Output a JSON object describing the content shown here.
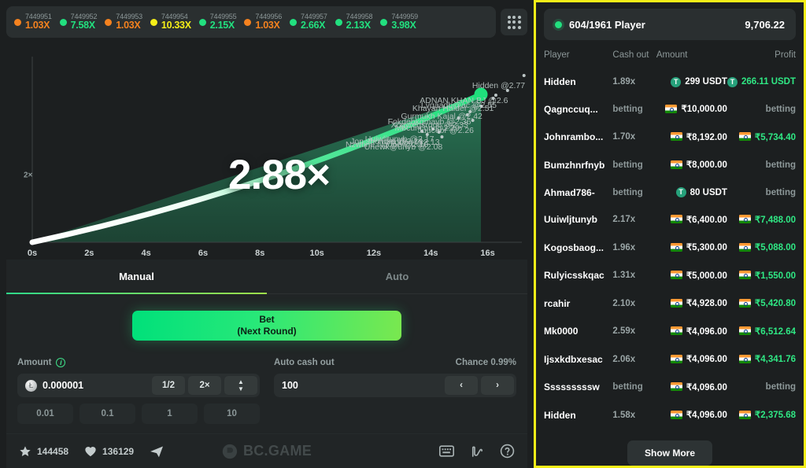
{
  "history": {
    "items": [
      {
        "id": "7449951",
        "mult": "1.03X",
        "color": "#f5821f"
      },
      {
        "id": "7449952",
        "mult": "7.58X",
        "color": "#22e07f"
      },
      {
        "id": "7449953",
        "mult": "1.03X",
        "color": "#f5821f"
      },
      {
        "id": "7449954",
        "mult": "10.33X",
        "color": "#f5ee18"
      },
      {
        "id": "7449955",
        "mult": "2.15X",
        "color": "#22e07f"
      },
      {
        "id": "7449956",
        "mult": "1.03X",
        "color": "#f5821f"
      },
      {
        "id": "7449957",
        "mult": "2.66X",
        "color": "#22e07f"
      },
      {
        "id": "7449958",
        "mult": "2.13X",
        "color": "#22e07f"
      },
      {
        "id": "7449959",
        "mult": "3.98X",
        "color": "#22e07f"
      }
    ],
    "grid_button_icon": "grid-3x3-icon"
  },
  "chart_data": {
    "type": "line",
    "title": "",
    "current_multiplier": "2.88×",
    "xlabel": "",
    "ylabel": "",
    "grid": false,
    "x_ticks": [
      "0s",
      "2s",
      "4s",
      "6s",
      "8s",
      "10s",
      "12s",
      "14s",
      "16s"
    ],
    "y_ticks": [
      "2×"
    ],
    "xlim": [
      0,
      17.2
    ],
    "ylim": [
      1,
      3.1
    ],
    "line_color_start": "#ffffff",
    "line_color_end": "#22e07f",
    "fill_color": "#1d5c42",
    "x": [
      0,
      2,
      4,
      6,
      8,
      10,
      12,
      14,
      16,
      17
    ],
    "y": [
      1.0,
      1.12,
      1.28,
      1.47,
      1.7,
      1.96,
      2.22,
      2.5,
      2.78,
      2.88
    ],
    "annotations": [
      {
        "label": "Hidden @2.77",
        "x": 15.6,
        "y": 2.77
      },
      {
        "label": "ADNAN KHAN BJ @2.6",
        "x": 15.0,
        "y": 2.6
      },
      {
        "label": "Lvqaadb@ac @2.55",
        "x": 14.6,
        "y": 2.55
      },
      {
        "label": "Khayan Haider @2.51",
        "x": 14.5,
        "y": 2.51
      },
      {
        "label": "Gurmukh Kajal @2.42",
        "x": 14.1,
        "y": 2.42
      },
      {
        "label": "Fokdebkqmavb @2.36",
        "x": 13.7,
        "y": 2.36
      },
      {
        "label": "Xcgyregsrqqc @2.33",
        "x": 13.6,
        "y": 2.33
      },
      {
        "label": "Mbcuncon @2.29",
        "x": 13.3,
        "y": 2.29
      },
      {
        "label": "Juuceor @2.26",
        "x": 13.8,
        "y": 2.26
      },
      {
        "label": "Uuiwljtunyb @2.17",
        "x": 12.4,
        "y": 2.17
      },
      {
        "label": "Jon Jhondra @2.14",
        "x": 12.0,
        "y": 2.14
      },
      {
        "label": "Hidden @2.13",
        "x": 12.6,
        "y": 2.13
      },
      {
        "label": "Nzwtine Ngope @2.10",
        "x": 12.2,
        "y": 2.1
      },
      {
        "label": "Unewk@unyb @2.08",
        "x": 12.7,
        "y": 2.08
      }
    ]
  },
  "tabs": [
    {
      "label": "Manual",
      "active": true
    },
    {
      "label": "Auto",
      "active": false
    }
  ],
  "bet": {
    "primary_line1": "Bet",
    "primary_line2": "(Next Round)"
  },
  "amount": {
    "label": "Amount",
    "info_icon": "info-icon",
    "coin_icon": "litecoin-coin-icon",
    "value": "0.000001",
    "half_label": "1/2",
    "double_label": "2×",
    "stepper_icon": "stepper-up-down-icon",
    "quick": [
      "0.01",
      "0.1",
      "1",
      "10"
    ]
  },
  "autocashout": {
    "label": "Auto cash out",
    "chance": "Chance 0.99%",
    "value": "100",
    "prev_icon": "chevron-left-icon",
    "next_icon": "chevron-right-icon"
  },
  "bottom_bar": {
    "star_icon": "star-icon",
    "star_count": "144458",
    "heart_icon": "heart-icon",
    "heart_count": "136129",
    "send_icon": "send-icon",
    "brand": "BC.GAME",
    "brand_logo_icon": "bc-game-logo-icon",
    "keyboard_icon": "keyboard-icon",
    "trend_icon": "trend-n-icon",
    "help_icon": "help-circle-icon"
  },
  "players_panel": {
    "live_dot_icon": "live-dot-icon",
    "title": "604/1961 Player",
    "total": "9,706.22",
    "columns": [
      "Player",
      "Cash out",
      "Amount",
      "Profit"
    ],
    "show_more": "Show More",
    "rows": [
      {
        "player": "Hidden",
        "cashout": "1.89x",
        "amount": "299 USDT",
        "amount_cur": "usdt",
        "profit": "266.11 USDT",
        "profit_cur": "usdt",
        "pending": false
      },
      {
        "player": "Qagnccuq...",
        "cashout": "betting",
        "amount": "₹10,000.00",
        "amount_cur": "inr",
        "profit": "betting",
        "profit_cur": "none",
        "pending": true
      },
      {
        "player": "Johnrambo...",
        "cashout": "1.70x",
        "amount": "₹8,192.00",
        "amount_cur": "inr",
        "profit": "₹5,734.40",
        "profit_cur": "inr",
        "pending": false
      },
      {
        "player": "Bumzhnrfnyb",
        "cashout": "betting",
        "amount": "₹8,000.00",
        "amount_cur": "inr",
        "profit": "betting",
        "profit_cur": "none",
        "pending": true
      },
      {
        "player": "Ahmad786-",
        "cashout": "betting",
        "amount": "80 USDT",
        "amount_cur": "usdt",
        "profit": "betting",
        "profit_cur": "none",
        "pending": true
      },
      {
        "player": "Uuiwljtunyb",
        "cashout": "2.17x",
        "amount": "₹6,400.00",
        "amount_cur": "inr",
        "profit": "₹7,488.00",
        "profit_cur": "inr",
        "pending": false
      },
      {
        "player": "Kogosbaog...",
        "cashout": "1.96x",
        "amount": "₹5,300.00",
        "amount_cur": "inr",
        "profit": "₹5,088.00",
        "profit_cur": "inr",
        "pending": false
      },
      {
        "player": "Rulyicsskqac",
        "cashout": "1.31x",
        "amount": "₹5,000.00",
        "amount_cur": "inr",
        "profit": "₹1,550.00",
        "profit_cur": "inr",
        "pending": false
      },
      {
        "player": "rcahir",
        "cashout": "2.10x",
        "amount": "₹4,928.00",
        "amount_cur": "inr",
        "profit": "₹5,420.80",
        "profit_cur": "inr",
        "pending": false
      },
      {
        "player": "Mk0000",
        "cashout": "2.59x",
        "amount": "₹4,096.00",
        "amount_cur": "inr",
        "profit": "₹6,512.64",
        "profit_cur": "inr",
        "pending": false
      },
      {
        "player": "Ijsxkdbxesac",
        "cashout": "2.06x",
        "amount": "₹4,096.00",
        "amount_cur": "inr",
        "profit": "₹4,341.76",
        "profit_cur": "inr",
        "pending": false
      },
      {
        "player": "Sssssssssw",
        "cashout": "betting",
        "amount": "₹4,096.00",
        "amount_cur": "inr",
        "profit": "betting",
        "profit_cur": "none",
        "pending": true
      },
      {
        "player": "Hidden",
        "cashout": "1.58x",
        "amount": "₹4,096.00",
        "amount_cur": "inr",
        "profit": "₹2,375.68",
        "profit_cur": "inr",
        "pending": false
      }
    ]
  }
}
